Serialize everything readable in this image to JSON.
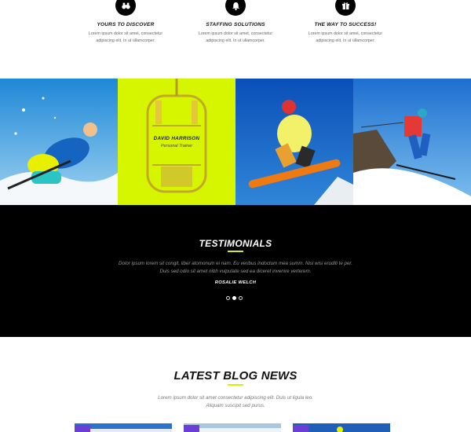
{
  "features": [
    {
      "title": "YOURS TO DISCOVER",
      "text_line1": "Lorem ipsum dolor sit amet, consectetur",
      "text_line2": "adipiscing elit. In ut ullamcorper.",
      "icon": "binoculars-icon"
    },
    {
      "title": "STAFFING SOLUTIONS",
      "text_line1": "Lorem ipsum dolor sit amet, consectetur",
      "text_line2": "adipiscing elit. In ut ullamcorper.",
      "icon": "bell-icon"
    },
    {
      "title": "THE WAY TO SUCCESS!",
      "text_line1": "Lorem ipsum dolor sit amet, consectetur",
      "text_line2": "adipiscing elit. In ut ullamcorper.",
      "icon": "gift-icon"
    }
  ],
  "gallery": {
    "caption_name": "DAVID HARRISON",
    "caption_role": "Personal Trainer",
    "overlay_color": "#d6f600"
  },
  "testimonials": {
    "title": "TESTIMONIALS",
    "quote_line1": "Dolor ipsum lorem sit congit, liber atomonum ei nam. Eu veribus indoctum mea summ. Nisl wisi eruditi te per.",
    "quote_line2": "Duis sed odio sit amet nibh vulputate sed ea diceret invenire verterem.",
    "author": "ROSALIE WELCH",
    "active_slide": 2,
    "slide_count": 3
  },
  "blog": {
    "title": "LATEST BLOG NEWS",
    "text_line1": "Lorem ipsum dolor sit amet consectetur adipiscing elit. Duis ut ligula leo.",
    "text_line2": "Aliquam suscipit sed purus."
  },
  "colors": {
    "accent": "#d8f000",
    "dark": "#000000",
    "badge": "#6b3fd6"
  }
}
